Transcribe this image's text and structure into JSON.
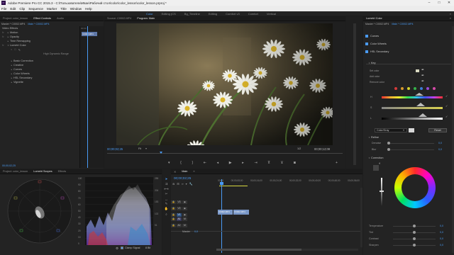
{
  "window": {
    "app_icon": "Pr",
    "title": "Adobe Premiere Pro CC 2015.3 - C:\\Пользователи\\Иван\\Рабочий стол\\color\\color_lesson\\color_lesson.prproj *",
    "minimize": "–",
    "maximize": "□",
    "close": "✕"
  },
  "menu": [
    "File",
    "Edit",
    "Clip",
    "Sequence",
    "Marker",
    "Title",
    "Window",
    "Help"
  ],
  "workspaces": [
    "Color",
    "Editing (CS",
    "Bg_Timeline",
    "Editing",
    "Comfort v3",
    "Comfort",
    "Vertical"
  ],
  "source_panel": {
    "tabs": [
      "Project: color_lesson",
      "Effect Controls",
      "Audio"
    ],
    "clip_header": {
      "master": "Master * C0002.MP4",
      "clip": "Main * C0002.MP4"
    },
    "ruler_time": "00:00",
    "timeline_clip": "C0002.MP4",
    "section": "Video Effects",
    "effects": [
      {
        "name": "Motion",
        "open": false
      },
      {
        "name": "Opacity",
        "open": false
      },
      {
        "name": "Time Remapping",
        "open": false
      },
      {
        "name": "Lumetri Color",
        "open": true
      }
    ],
    "hdr_label": "High Dynamic Range",
    "sub_sections": [
      "Basic Correction",
      "Creative",
      "Curves",
      "Color Wheels",
      "HSL Secondary",
      "Vignette"
    ],
    "footer_time": "00;00;02;25"
  },
  "program_monitor": {
    "tabs": [
      "Source: C0002.MP4",
      "Program: Main"
    ],
    "timecode": "00;00;02;25",
    "fit": "Fit",
    "fraction": "1/2",
    "duration": "00;00;12;08"
  },
  "lumetri_panel": {
    "tabs": [
      "Lumetri Color"
    ],
    "header": {
      "master": "Master * C0002.MP4",
      "clip": "Main * C0002.MP4"
    },
    "sections": [
      "Curves",
      "Color Wheels",
      "HSL Secondary"
    ],
    "key_label": "Key",
    "key_rows": [
      "Set color",
      "Add color",
      "Remove color"
    ],
    "hsl_labels": [
      "H",
      "S",
      "L"
    ],
    "preset_select": "Color/Gray",
    "reset_button": "Reset",
    "refine_label": "Refine",
    "refine_rows": [
      {
        "label": "Denoise",
        "value": "0,0"
      },
      {
        "label": "Blur",
        "value": "0,0"
      }
    ],
    "correction_label": "Correction",
    "sliders": [
      {
        "label": "Temperature",
        "value": "0,0"
      },
      {
        "label": "Tint",
        "value": "0,0"
      },
      {
        "label": "Contrast",
        "value": "0,0"
      },
      {
        "label": "Sharpen",
        "value": "0,0"
      }
    ]
  },
  "scopes_panel": {
    "tabs": [
      "Project: color_lesson",
      "Lumetri Scopes",
      "Effects"
    ],
    "ticks": [
      "100",
      "90",
      "80",
      "70",
      "60",
      "50",
      "40",
      "30",
      "20",
      "10",
      "0"
    ],
    "ticks_right": [
      "255",
      "204",
      "153",
      "102",
      "51"
    ],
    "mode": "Clamp Signal",
    "bit": "8 Bit"
  },
  "timeline": {
    "tab": "Main",
    "timecode": "00;00;02;25",
    "ruler": [
      "00;00",
      "00;00;08;00",
      "00;00;16;00",
      "00;00;24;00",
      "00;00;32;00",
      "00;00;40;00",
      "00;00;48;00",
      "00;00;56;00"
    ],
    "tracks": [
      {
        "id": "V3",
        "kind": "v"
      },
      {
        "id": "V2",
        "kind": "v"
      },
      {
        "id": "V1",
        "kind": "v",
        "clips": [
          "C0002.MP4",
          "C0002.MP4"
        ]
      },
      {
        "id": "A1",
        "kind": "a"
      },
      {
        "id": "A2",
        "kind": "a"
      },
      {
        "id": "Master",
        "kind": "m",
        "value": "0,0"
      }
    ]
  },
  "colors": {
    "accent": "#4a9bf5",
    "panel_bg": "#232323",
    "track_clip": "#7a98c8"
  }
}
